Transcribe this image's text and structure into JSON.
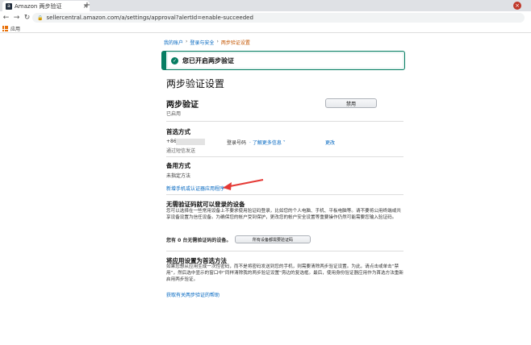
{
  "browser": {
    "tab_title": "Amazon 两步验证",
    "tab_favicon": "a",
    "url": "sellercentral.amazon.com/a/settings/approval?alertId=enable-succeeded",
    "bookmark_apps": "应用"
  },
  "breadcrumb": [
    "我的账户",
    "登录与安全",
    "两步验证设置"
  ],
  "alert": {
    "text": "您已开启两步验证"
  },
  "page_title": "两步验证设置",
  "tsv": {
    "title": "两步验证",
    "status": "已启用",
    "disable_label": "禁用"
  },
  "preferred": {
    "heading": "首选方式",
    "phone_prefix": "+86",
    "phone_sub": "通过短信发送",
    "login_code": "登录号码",
    "learn_more": "了解更多信息",
    "change": "更改"
  },
  "backup": {
    "heading": "备用方式",
    "status": "未指定方法",
    "add_link": "新增手机或认证器应用程序"
  },
  "devices": {
    "heading": "无需验证码就可以登录的设备",
    "desc": "您可以选择在一些常用设备上不要求使用验证码登录，比如您的个人电脑、手机、平板电脑等。请不要将公用终端或共享设备设置为信任设备。为确保您的帐户受到保护，更改您的帐户安全设置等重要操作仍然可能需要您输入验证码。",
    "count_text": "您有 0 台无需验证码的设备。",
    "button_label": "所有设备都需要验证码"
  },
  "app_preferred": {
    "heading": "将应用设置为首选方法",
    "desc": "如果您想从应用生成一次性密码，而不是将密码发送到您的手机，则需要清除两步验证设置。为此，请点击或单击“禁用”，然后选中显示的窗口中“同样清除我的两步验证设置”旁边的复选框。最后，使用身份验证器应用作为首选方法重新启用两步验证。",
    "help_link": "获取有关两步验证的帮助"
  },
  "colors": {
    "link": "#0066c0",
    "success": "#067d62",
    "arrow": "#e53935"
  }
}
